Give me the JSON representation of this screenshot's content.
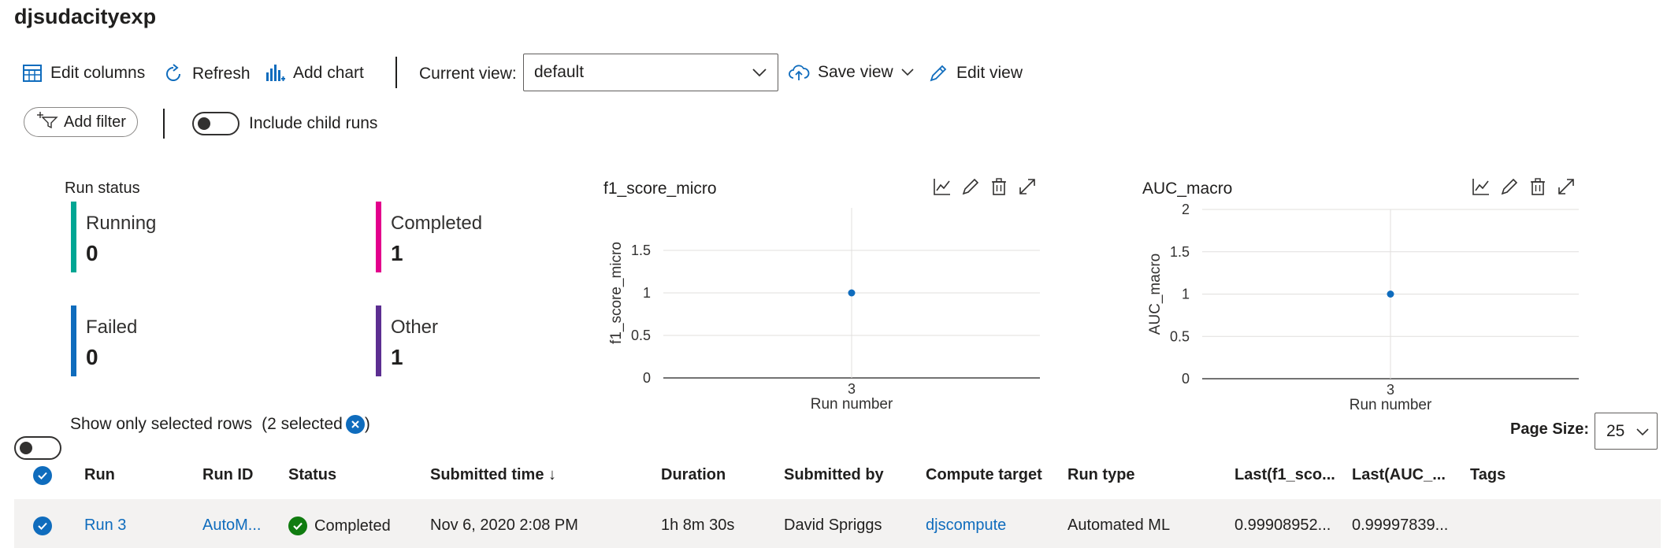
{
  "page": {
    "title": "djsudacityexp"
  },
  "toolbar": {
    "edit_columns": "Edit columns",
    "refresh": "Refresh",
    "add_chart": "Add chart",
    "current_view_label": "Current view:",
    "current_view_value": "default",
    "save_view": "Save view",
    "edit_view": "Edit view"
  },
  "filters": {
    "add_filter": "Add filter",
    "include_child_runs": "Include child runs"
  },
  "run_status": {
    "title": "Run status",
    "items": [
      {
        "label": "Running",
        "value": "0",
        "color": "#00a693"
      },
      {
        "label": "Completed",
        "value": "1",
        "color": "#e3008c"
      },
      {
        "label": "Failed",
        "value": "0",
        "color": "#0f6cbd"
      },
      {
        "label": "Other",
        "value": "1",
        "color": "#5c2e91"
      }
    ]
  },
  "chart_data": [
    {
      "type": "scatter",
      "title": "f1_score_micro",
      "xlabel": "Run number",
      "ylabel": "f1_score_micro",
      "x": [
        3
      ],
      "y": [
        1
      ],
      "xticks": [
        "3"
      ],
      "yticks": [
        "0",
        "0.5",
        "1",
        "1.5"
      ],
      "ylim": [
        0,
        2
      ],
      "grid": true,
      "color": "#0f6cbd"
    },
    {
      "type": "scatter",
      "title": "AUC_macro",
      "xlabel": "Run number",
      "ylabel": "AUC_macro",
      "x": [
        3
      ],
      "y": [
        1
      ],
      "xticks": [
        "3"
      ],
      "yticks": [
        "0",
        "0.5",
        "1",
        "1.5",
        "2"
      ],
      "ylim": [
        0,
        2
      ],
      "grid": true,
      "color": "#0f6cbd"
    }
  ],
  "selection": {
    "show_only_selected": "Show only selected rows",
    "selected_prefix": "(2 selected",
    "selected_suffix": ")"
  },
  "paging": {
    "label": "Page Size:",
    "value": "25"
  },
  "table": {
    "columns": [
      "Run",
      "Run ID",
      "Status",
      "Submitted time ↓",
      "Duration",
      "Submitted by",
      "Compute target",
      "Run type",
      "Last(f1_sco...",
      "Last(AUC_...",
      "Tags"
    ],
    "rows": [
      {
        "run": "Run 3",
        "run_id": "AutoM...",
        "status": "Completed",
        "submitted_time": "Nov 6, 2020 2:08 PM",
        "duration": "1h 8m 30s",
        "submitted_by": "David Spriggs",
        "compute_target": "djscompute",
        "run_type": "Automated ML",
        "last_f1": "0.99908952...",
        "last_auc": "0.99997839...",
        "tags": ""
      }
    ]
  },
  "colors": {
    "accent": "#0f6cbd",
    "success": "#107c10"
  }
}
